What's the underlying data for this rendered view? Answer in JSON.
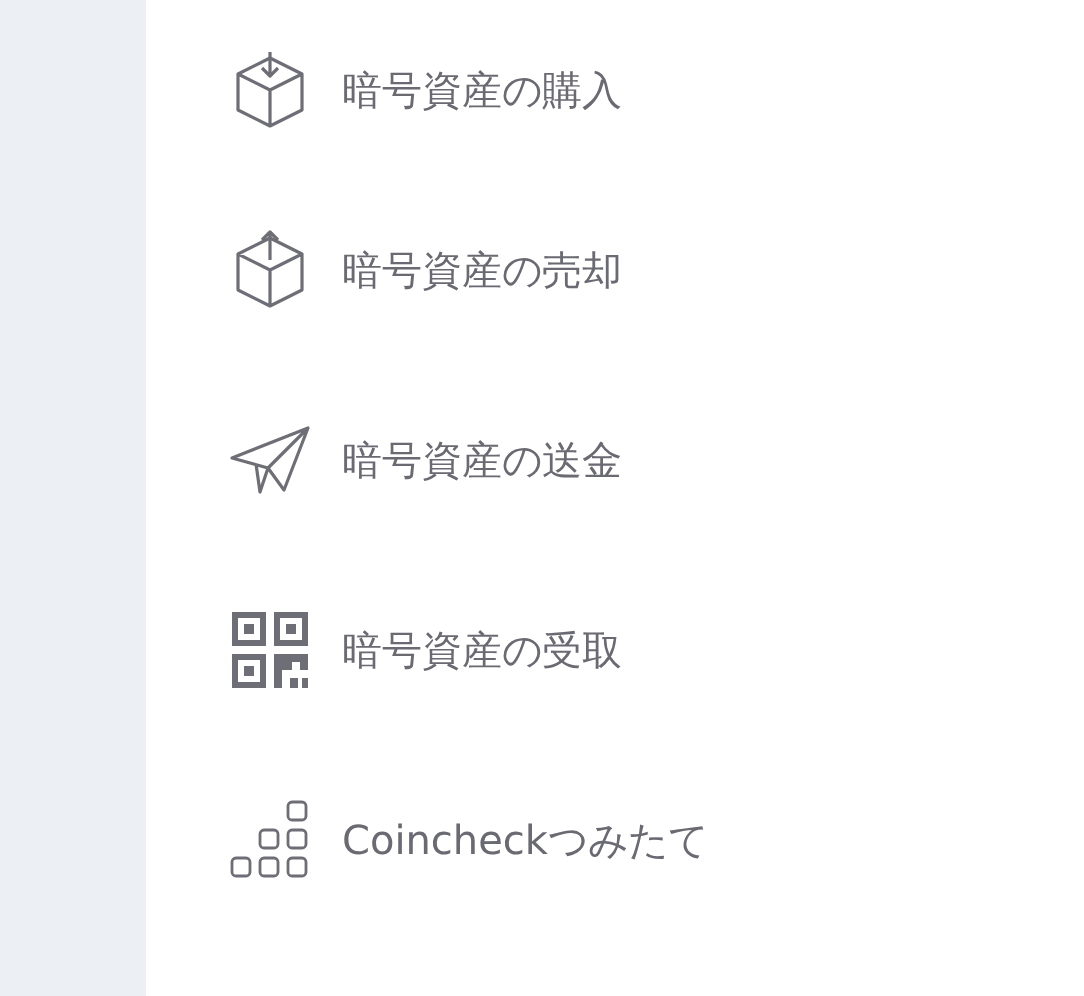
{
  "menu_items": [
    {
      "kind": "buy",
      "label": "暗号資産の購入"
    },
    {
      "kind": "sell",
      "label": "暗号資産の売却"
    },
    {
      "kind": "send",
      "label": "暗号資産の送金"
    },
    {
      "kind": "receive",
      "label": "暗号資産の受取"
    },
    {
      "kind": "recurring",
      "label": "Coincheckつみたて"
    }
  ]
}
